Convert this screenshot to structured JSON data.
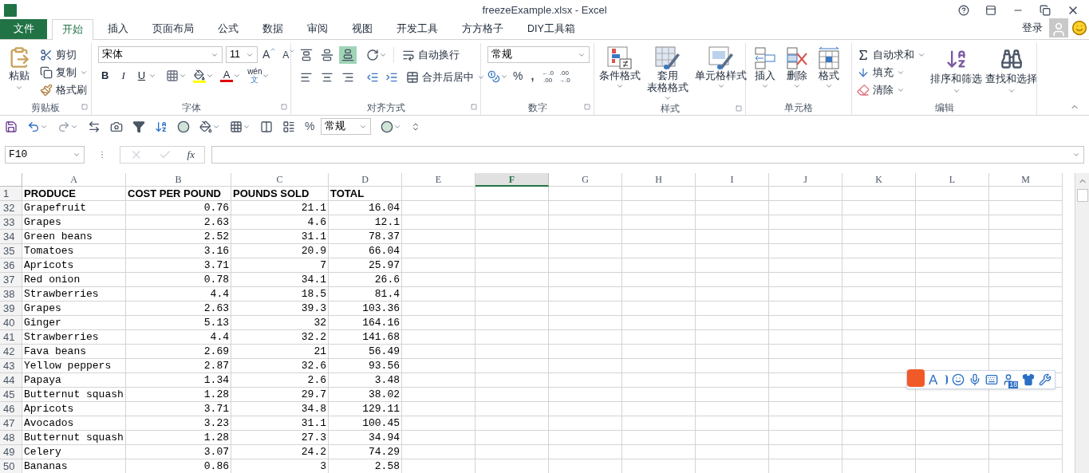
{
  "window": {
    "title": "freezeExample.xlsx - Excel"
  },
  "account": {
    "sign_in": "登录"
  },
  "tabs": [
    {
      "label": "文件",
      "kind": "file",
      "selected": false
    },
    {
      "label": "开始",
      "kind": "tab",
      "selected": true
    },
    {
      "label": "插入",
      "kind": "tab",
      "selected": false
    },
    {
      "label": "页面布局",
      "kind": "tab",
      "selected": false
    },
    {
      "label": "公式",
      "kind": "tab",
      "selected": false
    },
    {
      "label": "数据",
      "kind": "tab",
      "selected": false
    },
    {
      "label": "审阅",
      "kind": "tab",
      "selected": false
    },
    {
      "label": "视图",
      "kind": "tab",
      "selected": false
    },
    {
      "label": "开发工具",
      "kind": "tab",
      "selected": false
    },
    {
      "label": "方方格子",
      "kind": "tab",
      "selected": false
    },
    {
      "label": "DIY工具箱",
      "kind": "tab",
      "selected": false
    }
  ],
  "ribbon": {
    "clipboard": {
      "label": "剪贴板",
      "paste": "粘贴",
      "cut": "剪切",
      "copy": "复制",
      "painter": "格式刷"
    },
    "font": {
      "label": "字体",
      "name": "宋体",
      "size": "11",
      "grow": "A",
      "shrink": "A",
      "bold": "B",
      "italic": "I",
      "underline": "U",
      "color_button": "A",
      "phonetic_top": "wén",
      "phonetic_bottom": "文"
    },
    "alignment": {
      "label": "对齐方式",
      "wrap": "自动换行",
      "merge": "合并后居中",
      "vertical": [
        {
          "selected": false
        },
        {
          "selected": false
        },
        {
          "selected": true
        }
      ]
    },
    "number": {
      "label": "数字",
      "format": "常规",
      "percent": "%",
      "comma": ",",
      "increase": [
        "←.0",
        ".00"
      ],
      "decrease": [
        ".00",
        "→.0"
      ]
    },
    "styles": {
      "label": "样式",
      "buttons": [
        {
          "lines": [
            "条件格式"
          ],
          "kind": "conditional"
        },
        {
          "lines": [
            "套用",
            "表格格式"
          ],
          "kind": "table"
        },
        {
          "lines": [
            "单元格样式"
          ],
          "kind": "cellstyle"
        }
      ]
    },
    "cells": {
      "label": "单元格",
      "buttons": [
        {
          "label": "插入",
          "kind": "insert"
        },
        {
          "label": "删除",
          "kind": "delete"
        },
        {
          "label": "格式",
          "kind": "format"
        }
      ]
    },
    "editing": {
      "label": "编辑",
      "autosum": "自动求和",
      "fill": "填充",
      "clear": "清除",
      "sort": "排序和筛选",
      "find": "查找和选择"
    }
  },
  "quick_access": {
    "format": "常规",
    "percent": "%"
  },
  "formula_bar": {
    "name_box": "F10",
    "fx": "fx"
  },
  "sheet": {
    "columns": [
      {
        "label": "A",
        "selected": false
      },
      {
        "label": "B",
        "selected": false
      },
      {
        "label": "C",
        "selected": false
      },
      {
        "label": "D",
        "selected": false
      },
      {
        "label": "E",
        "selected": false
      },
      {
        "label": "F",
        "selected": true
      },
      {
        "label": "G",
        "selected": false
      },
      {
        "label": "H",
        "selected": false
      },
      {
        "label": "I",
        "selected": false
      },
      {
        "label": "J",
        "selected": false
      },
      {
        "label": "K",
        "selected": false
      },
      {
        "label": "L",
        "selected": false
      },
      {
        "label": "M",
        "selected": false
      }
    ],
    "header_row": {
      "number": "1",
      "cells": [
        "PRODUCE",
        "COST PER POUND",
        "POUNDS SOLD",
        "TOTAL"
      ]
    },
    "rows": [
      {
        "number": "32",
        "cells": [
          "Grapefruit",
          "0.76",
          "21.1",
          "16.04"
        ]
      },
      {
        "number": "33",
        "cells": [
          "Grapes",
          "2.63",
          "4.6",
          "12.1"
        ]
      },
      {
        "number": "34",
        "cells": [
          "Green beans",
          "2.52",
          "31.1",
          "78.37"
        ]
      },
      {
        "number": "35",
        "cells": [
          "Tomatoes",
          "3.16",
          "20.9",
          "66.04"
        ]
      },
      {
        "number": "36",
        "cells": [
          "Apricots",
          "3.71",
          "7",
          "25.97"
        ]
      },
      {
        "number": "37",
        "cells": [
          "Red onion",
          "0.78",
          "34.1",
          "26.6"
        ]
      },
      {
        "number": "38",
        "cells": [
          "Strawberries",
          "4.4",
          "18.5",
          "81.4"
        ]
      },
      {
        "number": "39",
        "cells": [
          "Grapes",
          "2.63",
          "39.3",
          "103.36"
        ]
      },
      {
        "number": "40",
        "cells": [
          "Ginger",
          "5.13",
          "32",
          "164.16"
        ]
      },
      {
        "number": "41",
        "cells": [
          "Strawberries",
          "4.4",
          "32.2",
          "141.68"
        ]
      },
      {
        "number": "42",
        "cells": [
          "Fava beans",
          "2.69",
          "21",
          "56.49"
        ]
      },
      {
        "number": "43",
        "cells": [
          "Yellow peppers",
          "2.87",
          "32.6",
          "93.56"
        ]
      },
      {
        "number": "44",
        "cells": [
          "Papaya",
          "1.34",
          "2.6",
          "3.48"
        ]
      },
      {
        "number": "45",
        "cells": [
          "Butternut squash",
          "1.28",
          "29.7",
          "38.02"
        ]
      },
      {
        "number": "46",
        "cells": [
          "Apricots",
          "3.71",
          "34.8",
          "129.11"
        ]
      },
      {
        "number": "47",
        "cells": [
          "Avocados",
          "3.23",
          "31.1",
          "100.45"
        ]
      },
      {
        "number": "48",
        "cells": [
          "Butternut squash",
          "1.28",
          "27.3",
          "34.94"
        ]
      },
      {
        "number": "49",
        "cells": [
          "Celery",
          "3.07",
          "24.2",
          "74.29"
        ]
      },
      {
        "number": "50",
        "cells": [
          "Bananas",
          "0.86",
          "3",
          "2.58"
        ]
      }
    ]
  },
  "ime_toolbar": {
    "letter": "A",
    "badge": "18"
  }
}
